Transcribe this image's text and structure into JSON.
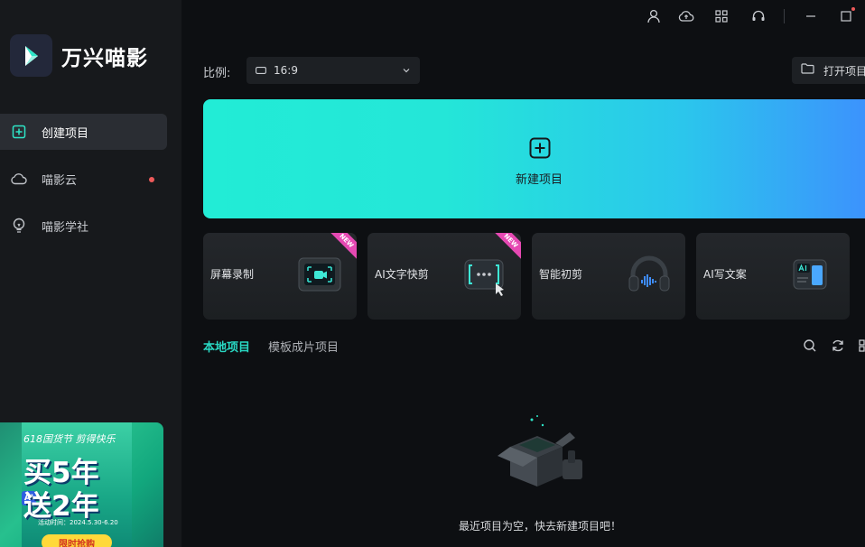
{
  "app": {
    "name": "万兴喵影"
  },
  "sidebar": {
    "items": [
      {
        "label": "创建项目",
        "icon": "create-project-icon",
        "active": true
      },
      {
        "label": "喵影云",
        "icon": "cloud-icon",
        "active": false,
        "has_badge": true
      },
      {
        "label": "喵影学社",
        "icon": "lightbulb-icon",
        "active": false
      }
    ],
    "promo": {
      "headline": "618国货节 剪得快乐",
      "line1": "买5年",
      "line2": "送2年",
      "ai_badge": "AI",
      "date": "活动时间：2024.5.30-6.20",
      "button": "限时抢购"
    }
  },
  "titlebar": {
    "icons": [
      "user-icon",
      "cloud-upload-icon",
      "grid-apps-icon",
      "headset-icon",
      "minimize-icon",
      "maximize-icon"
    ]
  },
  "ratio": {
    "label": "比例:",
    "value": "16:9"
  },
  "open_project": {
    "label": "打开项目"
  },
  "new_project": {
    "label": "新建项目"
  },
  "tools": [
    {
      "label": "屏幕录制",
      "new": true
    },
    {
      "label": "AI文字快剪",
      "new": true
    },
    {
      "label": "智能初剪",
      "new": false
    },
    {
      "label": "AI写文案",
      "new": false
    }
  ],
  "new_badge": "NEW",
  "tabs": [
    {
      "label": "本地项目",
      "active": true
    },
    {
      "label": "模板成片项目",
      "active": false
    }
  ],
  "empty_state": {
    "text": "最近项目为空，快去新建项目吧！"
  },
  "colors": {
    "accent": "#29d8c3",
    "badge": "#ee5a5a",
    "banner_start": "#22ecd6",
    "banner_end": "#3e8cff"
  }
}
